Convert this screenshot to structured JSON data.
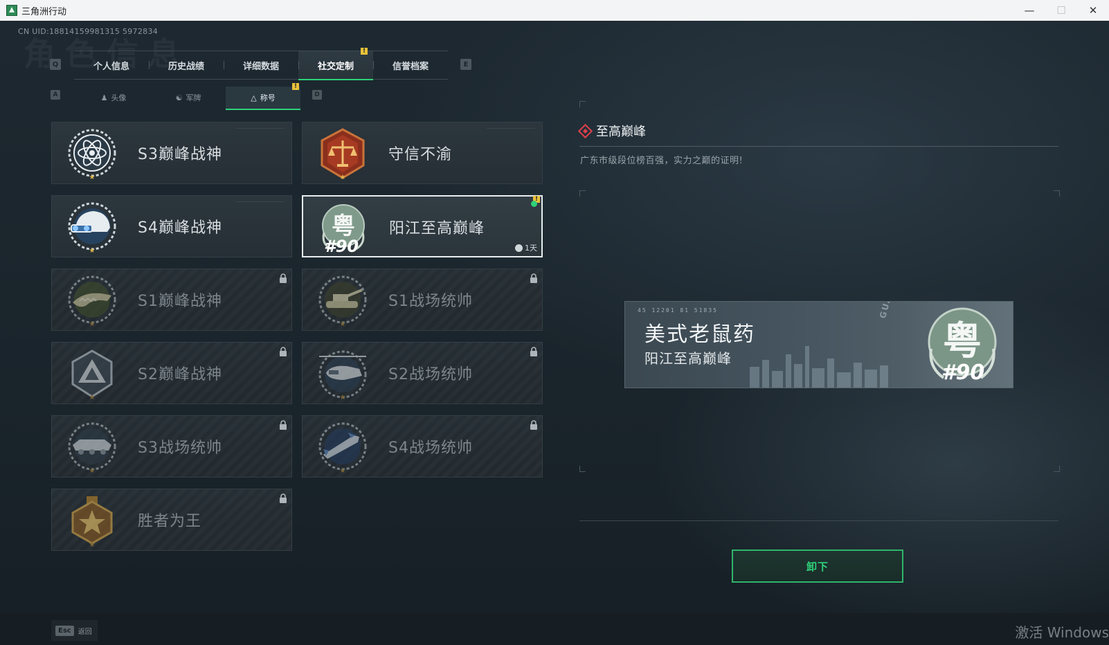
{
  "window": {
    "title": "三角洲行动",
    "controls": {
      "minimize": "—",
      "maximize": "☐",
      "close": "✕"
    }
  },
  "uid": "CN UID:18814159981315 5972834",
  "tabs": {
    "key_left": "Q",
    "key_right": "E",
    "items": [
      {
        "label": "个人信息",
        "active": false
      },
      {
        "label": "历史战绩",
        "active": false
      },
      {
        "label": "详细数据",
        "active": false
      },
      {
        "label": "社交定制",
        "active": true,
        "badge": "!"
      },
      {
        "label": "信誉档案",
        "active": false
      }
    ]
  },
  "subtabs": {
    "key_left": "A",
    "key_right": "D",
    "items": [
      {
        "label": "头像",
        "icon": "person-icon",
        "active": false
      },
      {
        "label": "军牌",
        "icon": "dogtag-icon",
        "active": false
      },
      {
        "label": "称号",
        "icon": "title-icon",
        "active": true,
        "badge": "!"
      }
    ]
  },
  "titles": [
    {
      "name": "S3巅峰战神",
      "medal": "atom-medal-icon",
      "locked": false
    },
    {
      "name": "守信不渝",
      "medal": "scales-medal-icon",
      "locked": false
    },
    {
      "name": "S4巅峰战神",
      "medal": "helmet-medal-icon",
      "locked": false
    },
    {
      "name": "阳江至高巅峰",
      "medal": "yue-medal-icon",
      "locked": false,
      "selected": true,
      "rank": "#90",
      "timer": "1天",
      "badge": "!"
    },
    {
      "name": "S1巅峰战神",
      "medal": "crocodile-medal-icon",
      "locked": true
    },
    {
      "name": "S1战场统帅",
      "medal": "tank-medal-icon",
      "locked": true
    },
    {
      "name": "S2巅峰战神",
      "medal": "pyramid-medal-icon",
      "locked": true
    },
    {
      "name": "S2战场统帅",
      "medal": "helicopter-medal-icon",
      "locked": true
    },
    {
      "name": "S3战场统帅",
      "medal": "apc-medal-icon",
      "locked": true
    },
    {
      "name": "S4战场统帅",
      "medal": "missile-medal-icon",
      "locked": true
    },
    {
      "name": "胜者为王",
      "medal": "gold-star-medal-icon",
      "locked": true
    }
  ],
  "detail": {
    "title": "至高巅峰",
    "description": "广东市级段位榜百强，实力之巅的证明!",
    "preview": {
      "player_name": "美式老鼠药",
      "title_name": "阳江至高巅峰",
      "code": "45 12201 81 51835",
      "region_text": "GUANGDONG",
      "medal_char": "粤",
      "rank": "#90"
    },
    "unequip_label": "卸下"
  },
  "footer": {
    "esc_key": "Esc",
    "esc_label": "返回"
  },
  "watermark": "激活 Windows",
  "colors": {
    "accent": "#2fd17a",
    "badge": "#e8c23a",
    "diamond": "#e0404a",
    "background": "#1b252d"
  }
}
